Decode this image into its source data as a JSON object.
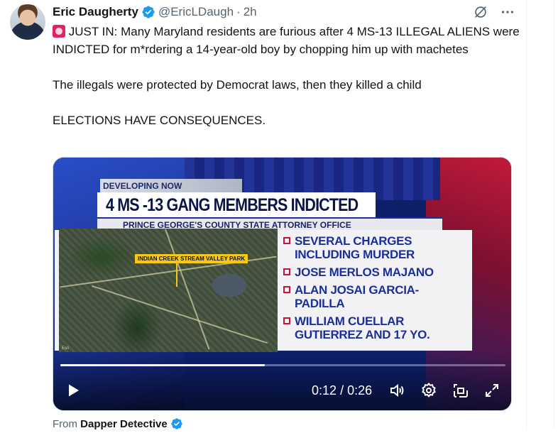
{
  "tweet": {
    "author_name": "Eric Daugherty",
    "handle": "@EricLDaugh",
    "separator": "·",
    "time_ago": "2h",
    "text_line1": " JUST IN: Many Maryland residents are furious after 4 MS-13 ILLEGAL ALIENS were INDICTED for m*rdering a 14-year-old boy by chopping him up with machetes",
    "text_para2": "The illegals were protected by Democrat laws, then they killed a child",
    "text_para3": "ELECTIONS HAVE CONSEQUENCES.",
    "icons": [
      "verified-badge-icon",
      "grok-icon",
      "more-icon",
      "siren-emoji-icon"
    ]
  },
  "video": {
    "developing": "DEVELOPING NOW",
    "headline": "4 MS -13 GANG MEMBERS INDICTED",
    "subline": "PRINCE GEORGE'S COUNTY STATE ATTORNEY OFFICE",
    "map_label": "INDIAN CREEK STREAM VALLEY PARK",
    "map_credit": "Esri",
    "charges": [
      "SEVERAL CHARGES INCLUDING MURDER",
      "JOSE MERLOS MAJANO",
      "ALAN JOSAI GARCIA-PADILLA",
      "WILLIAM CUELLAR GUTIERREZ AND 17 YO."
    ],
    "progress_fraction": 0.46,
    "current_time": "0:12",
    "time_separator": "/",
    "duration": "0:26",
    "controls": [
      "play-icon",
      "volume-icon",
      "settings-icon",
      "pip-icon",
      "fullscreen-icon"
    ]
  },
  "from": {
    "prefix": "From",
    "source": "Dapper Detective"
  },
  "colors": {
    "verified_blue": "#1d9bf0",
    "text_primary": "#0f1419",
    "text_secondary": "#536471"
  }
}
